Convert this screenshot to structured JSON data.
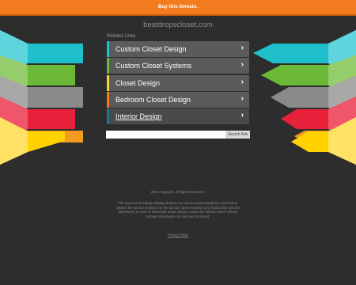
{
  "topbar": {
    "cta_label": "Buy this domain."
  },
  "header": {
    "domain": "beatdropscloset.com"
  },
  "related": {
    "heading": "Related Links",
    "items": [
      {
        "label": "Custom Closet Design",
        "accent": "#1fc0cc"
      },
      {
        "label": "Custom Closet Systems",
        "accent": "#6cb937"
      },
      {
        "label": "Closet Design",
        "accent": "#f0d63b"
      },
      {
        "label": "Bedroom Closet Design",
        "accent": "#f47c20"
      },
      {
        "label": "Interior Design",
        "accent": "#1b7a8c"
      }
    ]
  },
  "search": {
    "placeholder": "",
    "button_label": "Search Ads"
  },
  "footer": {
    "copyright": "2021 Copyright. All Rights Reserved.",
    "disclaimer": "The Sponsored Listings displayed above are served automatically by a third party. Neither the service provider nor the domain owner maintain any relationship with the advertisers. In case of trademark issues please contact the domain owner directly (contact information can be found in whois).",
    "privacy_label": "Privacy Policy"
  },
  "colors": {
    "cyan": "#1fc0cc",
    "green": "#6cb937",
    "gray": "#8a8a8a",
    "red": "#e8213a",
    "orange": "#f47c20",
    "yellow": "#ffd200"
  }
}
